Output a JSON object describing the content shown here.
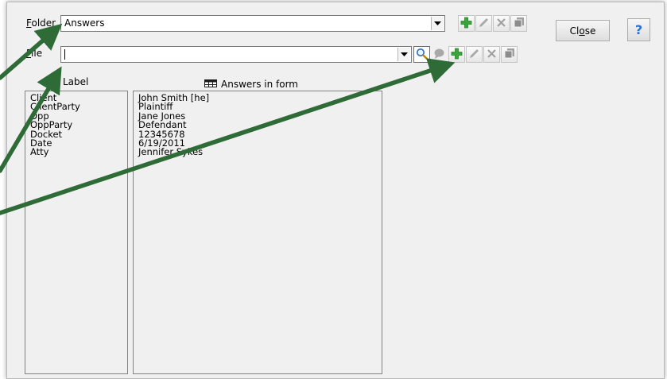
{
  "folder": {
    "label_prefix": "",
    "label_hotkey": "F",
    "label_rest": "older",
    "value": "Answers"
  },
  "file": {
    "label_hotkey": "F",
    "label_rest": "ile",
    "value": ""
  },
  "close_button": {
    "label_pre": "Cl",
    "label_hotkey": "o",
    "label_post": "se"
  },
  "help_button": {
    "label": "?"
  },
  "columns": {
    "left_header": "Label",
    "right_header": "Answers in form"
  },
  "labels": [
    "Client",
    "ClientParty",
    "Opp",
    "OppParty",
    "Docket",
    "Date",
    "Atty"
  ],
  "answers": [
    "John Smith [he]",
    "Plaintiff",
    "Jane Jones",
    "Defendant",
    "12345678",
    "6/19/2011",
    "Jennifer Sykes"
  ],
  "colors": {
    "arrow": "#2e6b36",
    "add_green": "#3aa53a",
    "dialog_bg": "#f0f0f0",
    "help_blue": "#2e6fd0"
  },
  "icons": [
    "dropdown-arrow-icon",
    "add-icon",
    "edit-icon",
    "delete-icon",
    "copy-icon",
    "search-icon",
    "comment-icon",
    "grid-icon"
  ]
}
